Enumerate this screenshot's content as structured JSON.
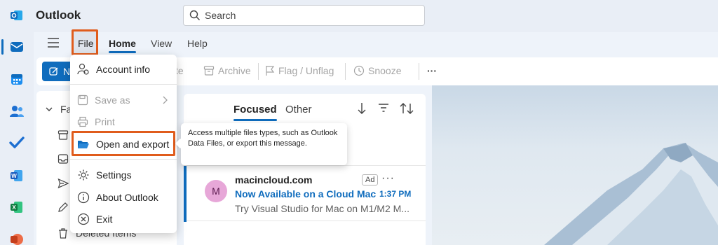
{
  "app": {
    "title": "Outlook"
  },
  "search": {
    "placeholder": "Search"
  },
  "ribbon": {
    "tabs": [
      "File",
      "Home",
      "View",
      "Help"
    ],
    "active_tab": "Home"
  },
  "toolbar": {
    "new_label": "N",
    "delete_label": "te",
    "archive_label": "Archive",
    "flag_label": "Flag / Unflag",
    "snooze_label": "Snooze",
    "more_label": "···"
  },
  "file_menu": {
    "items": [
      {
        "label": "Account info",
        "icon": "person-gear-icon",
        "disabled": false
      },
      {
        "label": "Save as",
        "icon": "save-icon",
        "disabled": true,
        "submenu": true
      },
      {
        "label": "Print",
        "icon": "print-icon",
        "disabled": true
      },
      {
        "label": "Open and export",
        "icon": "folder-open-icon",
        "disabled": false,
        "highlighted": true
      },
      {
        "label": "Settings",
        "icon": "gear-icon",
        "disabled": false
      },
      {
        "label": "About Outlook",
        "icon": "info-icon",
        "disabled": false
      },
      {
        "label": "Exit",
        "icon": "close-circle-icon",
        "disabled": false
      }
    ]
  },
  "tooltip": {
    "text": "Access multiple files types, such as Outlook Data Files, or export this message."
  },
  "folders": {
    "favorites_label": "Fav",
    "deleted_label": "Deleted Items"
  },
  "message_list": {
    "tabs": [
      "Focused",
      "Other"
    ],
    "active_tab": "Focused",
    "messages": [
      {
        "avatar_initial": "M",
        "sender": "macincloud.com",
        "ad_badge": "Ad",
        "more": "···",
        "subject": "Now Available on a Cloud Mac",
        "time": "1:37 PM",
        "preview": "Try Visual Studio for Mac on M1/M2 M..."
      }
    ]
  },
  "colors": {
    "accent": "#0f6cbd",
    "highlight_box": "#e05c1c",
    "avatar_bg": "#e7a7d8"
  }
}
